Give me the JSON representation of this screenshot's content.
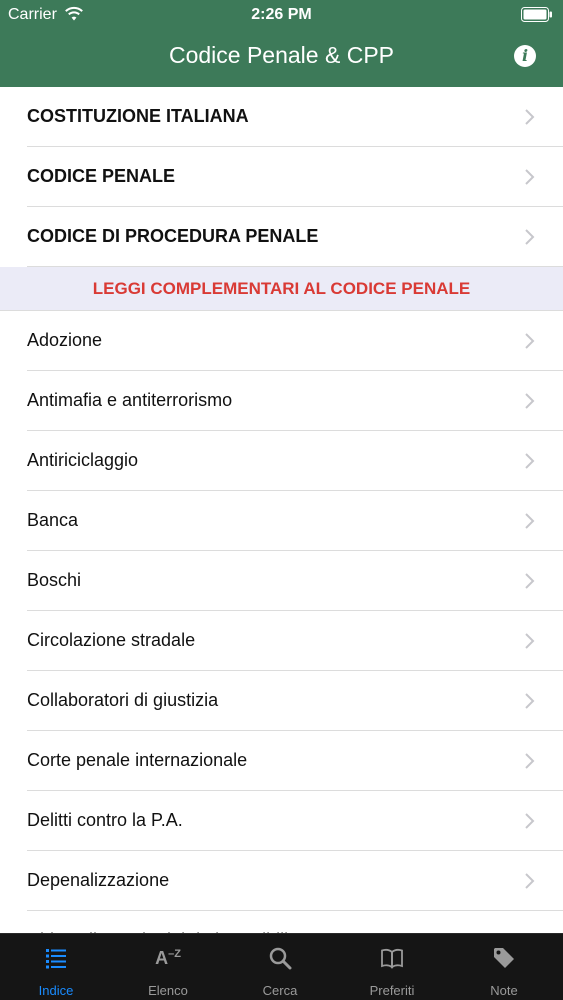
{
  "status_bar": {
    "carrier": "Carrier",
    "time": "2:26 PM"
  },
  "nav": {
    "title": "Codice Penale &  CPP",
    "info_label": "i"
  },
  "main_items": [
    {
      "label": "COSTITUZIONE ITALIANA"
    },
    {
      "label": "CODICE PENALE"
    },
    {
      "label": "CODICE DI PROCEDURA PENALE"
    }
  ],
  "section": {
    "title": "LEGGI COMPLEMENTARI AL CODICE PENALE"
  },
  "items": [
    {
      "label": "Adozione"
    },
    {
      "label": "Antimafia e antiterrorismo"
    },
    {
      "label": "Antiriciclaggio"
    },
    {
      "label": "Banca"
    },
    {
      "label": "Boschi"
    },
    {
      "label": "Circolazione stradale"
    },
    {
      "label": "Collaboratori di giustizia"
    },
    {
      "label": "Corte penale internazionale"
    },
    {
      "label": "Delitti contro la P.A."
    },
    {
      "label": "Depenalizzazione"
    },
    {
      "label": "Diritto alla tutela dei dati sensibili"
    }
  ],
  "tabs": [
    {
      "label": "Indice",
      "icon": "list-icon",
      "active": true
    },
    {
      "label": "Elenco",
      "icon": "az-icon",
      "active": false
    },
    {
      "label": "Cerca",
      "icon": "search-icon",
      "active": false
    },
    {
      "label": "Preferiti",
      "icon": "book-icon",
      "active": false
    },
    {
      "label": "Note",
      "icon": "tag-icon",
      "active": false
    }
  ],
  "colors": {
    "header_bg": "#3d7a59",
    "section_bg": "#ebebf7",
    "section_text": "#d93a35",
    "tabbar_bg": "#151515",
    "tab_active": "#1a8cff",
    "tab_inactive": "#9a9a9a"
  }
}
